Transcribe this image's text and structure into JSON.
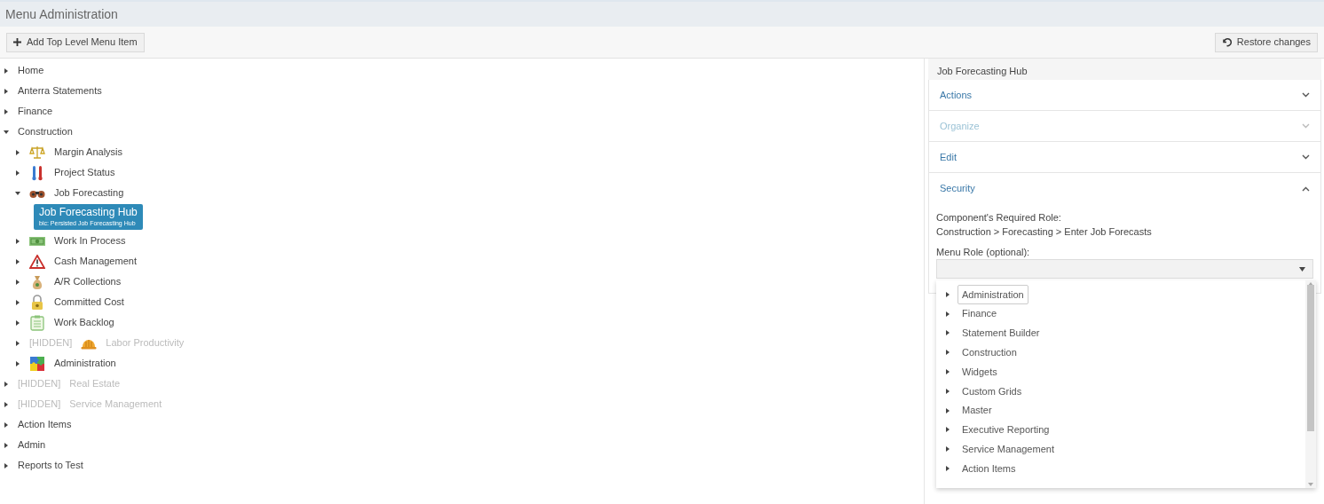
{
  "header": {
    "title": "Menu Administration"
  },
  "toolbar": {
    "add_button": "Add Top Level Menu Item",
    "restore_button": "Restore changes"
  },
  "tree": [
    {
      "label": "Home",
      "expanded": false,
      "hidden": false,
      "selected": false
    },
    {
      "label": "Anterra Statements",
      "expanded": false,
      "hidden": false,
      "selected": false
    },
    {
      "label": "Finance",
      "expanded": false,
      "hidden": false,
      "selected": false
    },
    {
      "label": "Construction",
      "expanded": true,
      "hidden": false,
      "selected": false,
      "children": [
        {
          "label": "Margin Analysis",
          "expanded": false,
          "hidden": false,
          "selected": false
        },
        {
          "label": "Project Status",
          "expanded": false,
          "hidden": false,
          "selected": false
        },
        {
          "label": "Job Forecasting",
          "expanded": true,
          "hidden": false,
          "selected": false,
          "children": [
            {
              "label": "Job Forecasting Hub",
              "subtitle": "bic: Persisted Job Forecasting Hub",
              "selected": true
            }
          ]
        },
        {
          "label": "Work In Process",
          "expanded": false,
          "hidden": false,
          "selected": false
        },
        {
          "label": "Cash Management",
          "expanded": false,
          "hidden": false,
          "selected": false
        },
        {
          "label": "A/R Collections",
          "expanded": false,
          "hidden": false,
          "selected": false
        },
        {
          "label": "Committed Cost",
          "expanded": false,
          "hidden": false,
          "selected": false
        },
        {
          "label": "Work Backlog",
          "expanded": false,
          "hidden": false,
          "selected": false
        },
        {
          "label": "Labor Productivity",
          "tag": "[HIDDEN]",
          "expanded": false,
          "hidden": true,
          "selected": false
        },
        {
          "label": "Administration",
          "expanded": false,
          "hidden": false,
          "selected": false
        }
      ]
    },
    {
      "label": "Real Estate",
      "tag": "[HIDDEN]",
      "expanded": false,
      "hidden": true,
      "selected": false
    },
    {
      "label": "Service Management",
      "tag": "[HIDDEN]",
      "expanded": false,
      "hidden": true,
      "selected": false
    },
    {
      "label": "Action Items",
      "expanded": false,
      "hidden": false,
      "selected": false
    },
    {
      "label": "Admin",
      "expanded": false,
      "hidden": false,
      "selected": false
    },
    {
      "label": "Reports to Test",
      "expanded": false,
      "hidden": false,
      "selected": false
    }
  ],
  "panel": {
    "title": "Job Forecasting Hub",
    "sections": [
      {
        "label": "Actions",
        "expanded": false,
        "disabled": false
      },
      {
        "label": "Organize",
        "expanded": false,
        "disabled": true
      },
      {
        "label": "Edit",
        "expanded": false,
        "disabled": false
      },
      {
        "label": "Security",
        "expanded": true,
        "disabled": false
      }
    ],
    "security": {
      "required_role_label": "Component's Required Role:",
      "required_role_value": "Construction > Forecasting > Enter Job Forecasts",
      "menu_role_label": "Menu Role (optional):",
      "dropdown_items": [
        {
          "label": "Administration",
          "selected": true
        },
        {
          "label": "Finance",
          "selected": false
        },
        {
          "label": "Statement Builder",
          "selected": false
        },
        {
          "label": "Construction",
          "selected": false
        },
        {
          "label": "Widgets",
          "selected": false
        },
        {
          "label": "Custom Grids",
          "selected": false
        },
        {
          "label": "Master",
          "selected": false
        },
        {
          "label": "Executive Reporting",
          "selected": false
        },
        {
          "label": "Service Management",
          "selected": false
        },
        {
          "label": "Action Items",
          "selected": false
        }
      ]
    }
  }
}
